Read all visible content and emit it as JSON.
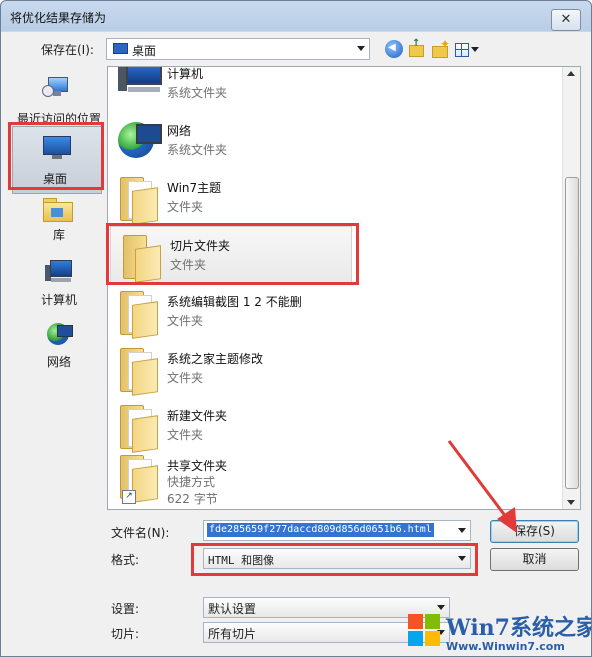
{
  "window": {
    "title": "将优化结果存储为",
    "close_glyph": "✕"
  },
  "toolbar": {
    "save_in_label": "保存在(I):",
    "save_in_value": "桌面",
    "icons": [
      "back-icon",
      "up-folder-icon",
      "new-folder-icon",
      "views-menu-icon"
    ]
  },
  "places": [
    {
      "label": "最近访问的位置",
      "icon": "recent-places-icon"
    },
    {
      "label": "桌面",
      "icon": "desktop-icon",
      "selected": true
    },
    {
      "label": "库",
      "icon": "library-icon"
    },
    {
      "label": "计算机",
      "icon": "computer-icon"
    },
    {
      "label": "网络",
      "icon": "network-icon"
    }
  ],
  "files": [
    {
      "name": "计算机",
      "type": "系统文件夹",
      "icon": "computer-icon"
    },
    {
      "name": "网络",
      "type": "系统文件夹",
      "icon": "network-icon"
    },
    {
      "name": "Win7主题",
      "type": "文件夹",
      "icon": "folder-icon"
    },
    {
      "name": "切片文件夹",
      "type": "文件夹",
      "icon": "folder-icon",
      "selected": true
    },
    {
      "name": "系统编辑截图 1 2 不能删",
      "type": "文件夹",
      "icon": "folder-icon"
    },
    {
      "name": "系统之家主题修改",
      "type": "文件夹",
      "icon": "folder-icon"
    },
    {
      "name": "新建文件夹",
      "type": "文件夹",
      "icon": "folder-icon"
    },
    {
      "name": "共享文件夹",
      "type": "快捷方式",
      "size": "622 字节",
      "icon": "shortcut-folder-icon"
    }
  ],
  "form": {
    "filename_label": "文件名(N):",
    "filename_value": "fde285659f277daccd809d856d0651b6.html",
    "format_label": "格式:",
    "format_value": "HTML 和图像",
    "settings_label": "设置:",
    "settings_value": "默认设置",
    "slices_label": "切片:",
    "slices_value": "所有切片"
  },
  "buttons": {
    "save": "保存(S)",
    "cancel": "取消"
  },
  "watermark": {
    "brand": "Win7系统之家",
    "url": "Www.Winwin7.com"
  },
  "colors": {
    "highlight_red": "#e03a3a",
    "selection_blue": "#3374d1"
  }
}
